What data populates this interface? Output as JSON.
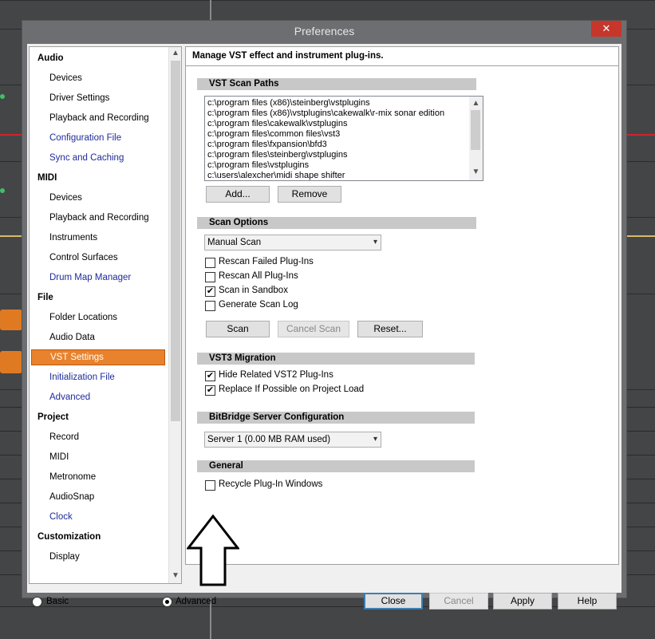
{
  "window": {
    "title": "Preferences",
    "close_glyph": "✕"
  },
  "tree": {
    "categories": [
      {
        "label": "Audio",
        "items": [
          {
            "label": "Devices",
            "style": "normal"
          },
          {
            "label": "Driver Settings",
            "style": "normal"
          },
          {
            "label": "Playback and Recording",
            "style": "normal"
          },
          {
            "label": "Configuration File",
            "style": "link"
          },
          {
            "label": "Sync and Caching",
            "style": "link"
          }
        ]
      },
      {
        "label": "MIDI",
        "items": [
          {
            "label": "Devices",
            "style": "normal"
          },
          {
            "label": "Playback and Recording",
            "style": "normal"
          },
          {
            "label": "Instruments",
            "style": "normal"
          },
          {
            "label": "Control Surfaces",
            "style": "normal"
          },
          {
            "label": "Drum Map Manager",
            "style": "link"
          }
        ]
      },
      {
        "label": "File",
        "items": [
          {
            "label": "Folder Locations",
            "style": "normal"
          },
          {
            "label": "Audio Data",
            "style": "normal"
          },
          {
            "label": "VST Settings",
            "style": "selected"
          },
          {
            "label": "Initialization File",
            "style": "link"
          },
          {
            "label": "Advanced",
            "style": "link"
          }
        ]
      },
      {
        "label": "Project",
        "items": [
          {
            "label": "Record",
            "style": "normal"
          },
          {
            "label": "MIDI",
            "style": "normal"
          },
          {
            "label": "Metronome",
            "style": "normal"
          },
          {
            "label": "AudioSnap",
            "style": "normal"
          },
          {
            "label": "Clock",
            "style": "link"
          }
        ]
      },
      {
        "label": "Customization",
        "items": [
          {
            "label": "Display",
            "style": "normal"
          }
        ]
      }
    ]
  },
  "panel": {
    "header": "Manage VST effect and instrument plug-ins.",
    "scan_paths": {
      "title": "VST Scan Paths",
      "paths": [
        "c:\\program files (x86)\\steinberg\\vstplugins",
        "c:\\program files (x86)\\vstplugins\\cakewalk\\r-mix sonar edition",
        "c:\\program files\\cakewalk\\vstplugins",
        "c:\\program files\\common files\\vst3",
        "c:\\program files\\fxpansion\\bfd3",
        "c:\\program files\\steinberg\\vstplugins",
        "c:\\program files\\vstplugins",
        "c:\\users\\alexcher\\midi shape shifter"
      ],
      "add_label": "Add...",
      "remove_label": "Remove"
    },
    "scan_options": {
      "title": "Scan Options",
      "mode": "Manual Scan",
      "checks": [
        {
          "label": "Rescan Failed Plug-Ins",
          "checked": false
        },
        {
          "label": "Rescan All Plug-Ins",
          "checked": false
        },
        {
          "label": "Scan in Sandbox",
          "checked": true
        },
        {
          "label": "Generate Scan Log",
          "checked": false
        }
      ],
      "scan_label": "Scan",
      "cancel_scan_label": "Cancel Scan",
      "reset_label": "Reset..."
    },
    "vst3": {
      "title": "VST3 Migration",
      "checks": [
        {
          "label": "Hide Related VST2 Plug-Ins",
          "checked": true
        },
        {
          "label": "Replace If Possible on Project Load",
          "checked": true
        }
      ]
    },
    "bitbridge": {
      "title": "BitBridge Server Configuration",
      "server": "Server 1  (0.00  MB RAM used)"
    },
    "general": {
      "title": "General",
      "checks": [
        {
          "label": "Recycle Plug-In Windows",
          "checked": false
        }
      ]
    }
  },
  "footer": {
    "basic_label": "Basic",
    "advanced_label": "Advanced",
    "mode": "advanced",
    "close_label": "Close",
    "cancel_label": "Cancel",
    "apply_label": "Apply",
    "help_label": "Help"
  },
  "colors": {
    "selected_bg": "#e8822c",
    "link_text": "#1f2b9a",
    "close_red": "#c7362b"
  }
}
